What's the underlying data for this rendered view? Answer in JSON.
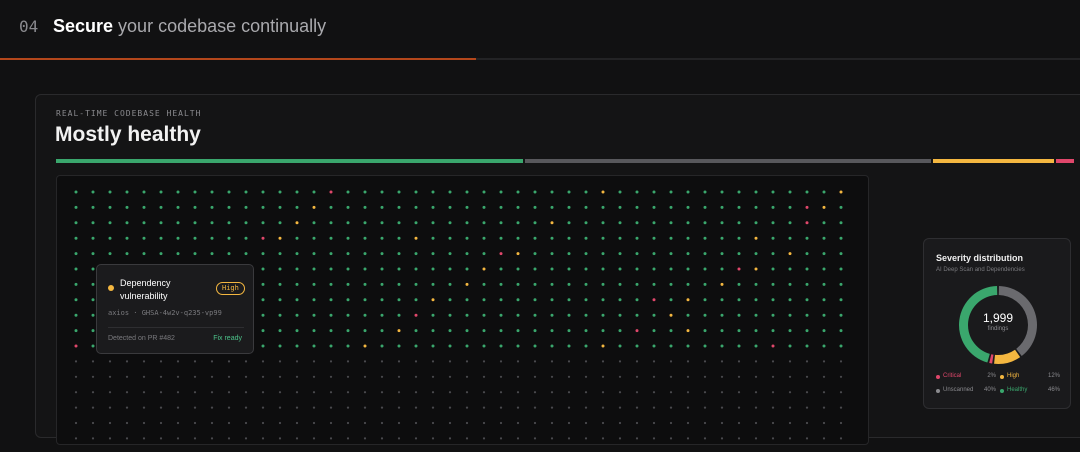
{
  "header": {
    "step_number": "04",
    "headline_bold": "Secure",
    "headline_rest": " your codebase continually"
  },
  "card": {
    "eyebrow": "REAL-TIME CODEBASE HEALTH",
    "status": "Mostly healthy",
    "health_bar": [
      {
        "name": "Healthy",
        "share": 0.46,
        "color": "#3aa76d"
      },
      {
        "name": "Unscanned",
        "share": 0.4,
        "color": "#58585c"
      },
      {
        "name": "High",
        "share": 0.12,
        "color": "#f4b740"
      },
      {
        "name": "Critical",
        "share": 0.02,
        "color": "#e0476b"
      }
    ]
  },
  "grid": {
    "columns": 46,
    "scanned_rows": 11,
    "unscanned_rows": 6,
    "colors": {
      "healthy": "#3aa76d",
      "high": "#f4b740",
      "critical": "#e0476b",
      "unscanned": "#4a4a4e"
    }
  },
  "tooltip": {
    "title": "Dependency vulnerability",
    "badge": "High",
    "meta": "axios · GHSA-4w2v-q235-vp99",
    "footer": "Detected on PR #482",
    "action": "Fix ready"
  },
  "severity": {
    "title": "Severity distribution",
    "subtitle": "AI Deep Scan and Dependencies",
    "total": "1,999",
    "total_label": "findings",
    "segments": [
      {
        "name": "Unscanned",
        "value": 40,
        "color": "#6a6a6e"
      },
      {
        "name": "High",
        "value": 12,
        "color": "#f4b740"
      },
      {
        "name": "Critical",
        "value": 2,
        "color": "#e0476b"
      },
      {
        "name": "Healthy",
        "value": 46,
        "color": "#3aa76d"
      }
    ],
    "legend": [
      {
        "name": "Critical",
        "pct": "2%",
        "color": "#e0476b"
      },
      {
        "name": "High",
        "pct": "12%",
        "color": "#f4b740"
      },
      {
        "name": "Unscanned",
        "pct": "40%",
        "color": "#8a8a8e"
      },
      {
        "name": "Healthy",
        "pct": "46%",
        "color": "#3aa76d"
      }
    ]
  }
}
